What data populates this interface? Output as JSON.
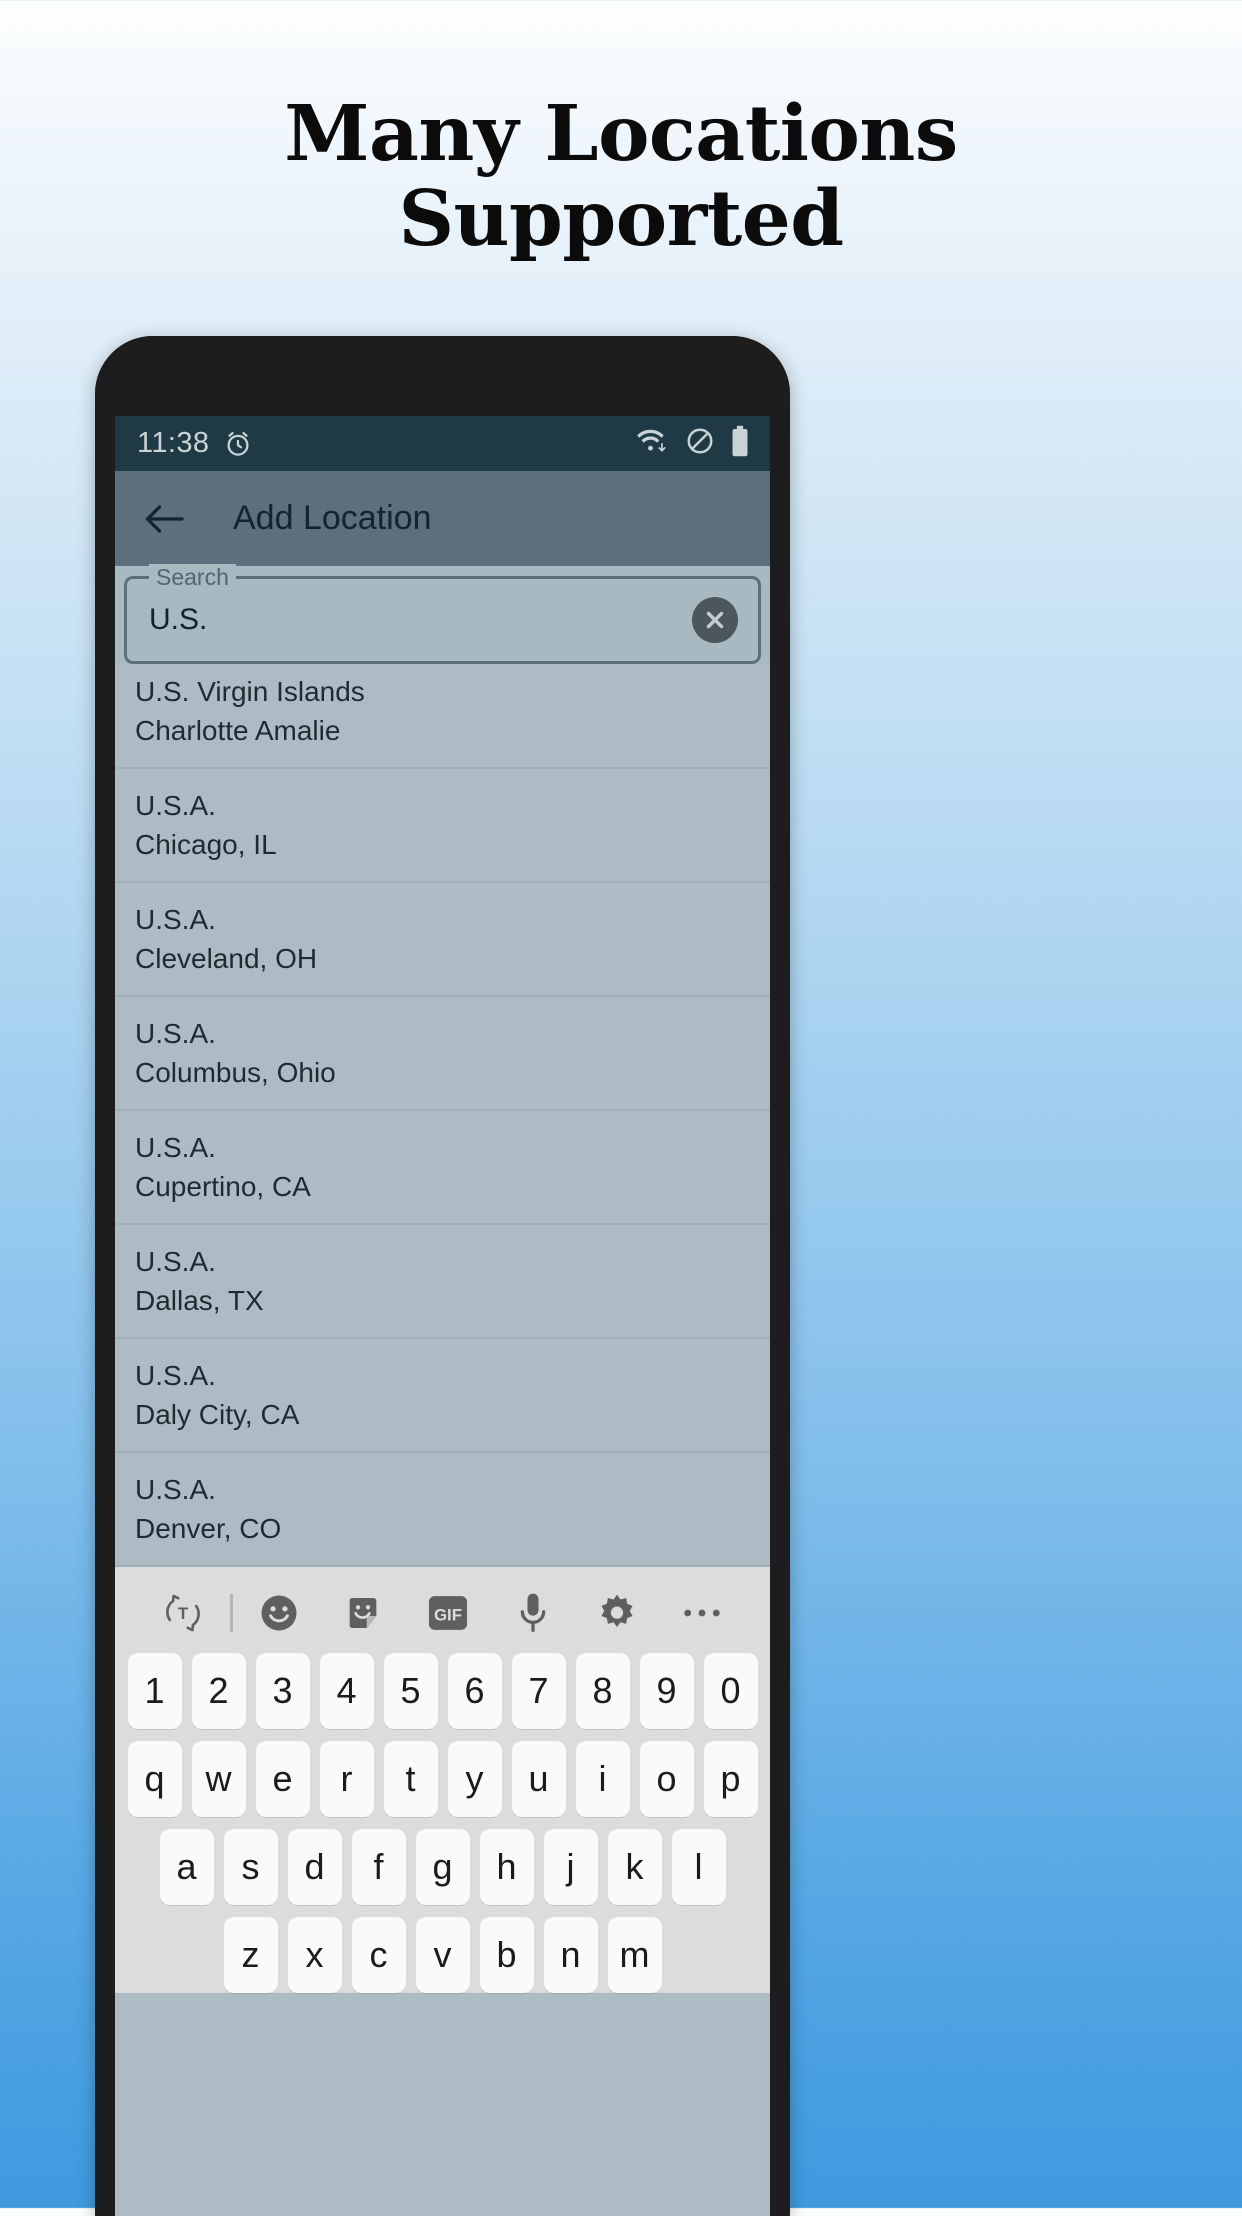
{
  "promo": {
    "headline_line1": "Many Locations",
    "headline_line2": "Supported"
  },
  "statusbar": {
    "time": "11:38",
    "alarm_icon": "alarm-clock-icon",
    "wifi_icon": "wifi-data-icon",
    "dnd_icon": "do-not-disturb-icon",
    "battery_icon": "battery-full-icon"
  },
  "appbar": {
    "back_icon": "back-arrow-icon",
    "title": "Add Location"
  },
  "search": {
    "label": "Search",
    "value": "U.S.",
    "placeholder": "Search",
    "clear_icon": "clear-circle-icon"
  },
  "results": [
    {
      "country": "U.S. Virgin Islands",
      "city": "Charlotte Amalie"
    },
    {
      "country": "U.S.A.",
      "city": "Chicago, IL"
    },
    {
      "country": "U.S.A.",
      "city": "Cleveland, OH"
    },
    {
      "country": "U.S.A.",
      "city": "Columbus, Ohio"
    },
    {
      "country": "U.S.A.",
      "city": "Cupertino, CA"
    },
    {
      "country": "U.S.A.",
      "city": "Dallas, TX"
    },
    {
      "country": "U.S.A.",
      "city": "Daly City, CA"
    },
    {
      "country": "U.S.A.",
      "city": "Denver, CO"
    }
  ],
  "keyboard": {
    "toolbar": [
      "translate-icon",
      "divider",
      "emoji-icon",
      "sticker-icon",
      "gif-icon",
      "microphone-icon",
      "gear-icon",
      "more-options-icon"
    ],
    "gif_label": "GIF",
    "row_numbers": [
      "1",
      "2",
      "3",
      "4",
      "5",
      "6",
      "7",
      "8",
      "9",
      "0"
    ],
    "row_top": [
      "q",
      "w",
      "e",
      "r",
      "t",
      "y",
      "u",
      "i",
      "o",
      "p"
    ],
    "row_home": [
      "a",
      "s",
      "d",
      "f",
      "g",
      "h",
      "j",
      "k",
      "l"
    ],
    "row_bottom": [
      "z",
      "x",
      "c",
      "v",
      "b",
      "n",
      "m"
    ]
  },
  "colors": {
    "statusbar_bg": "#1f3a44",
    "appbar_bg": "#5b707c",
    "list_bg": "#adbcc4",
    "keyboard_bg": "#dcdcdc",
    "key_bg": "#fafafa",
    "bezel": "#1d1d1d"
  }
}
